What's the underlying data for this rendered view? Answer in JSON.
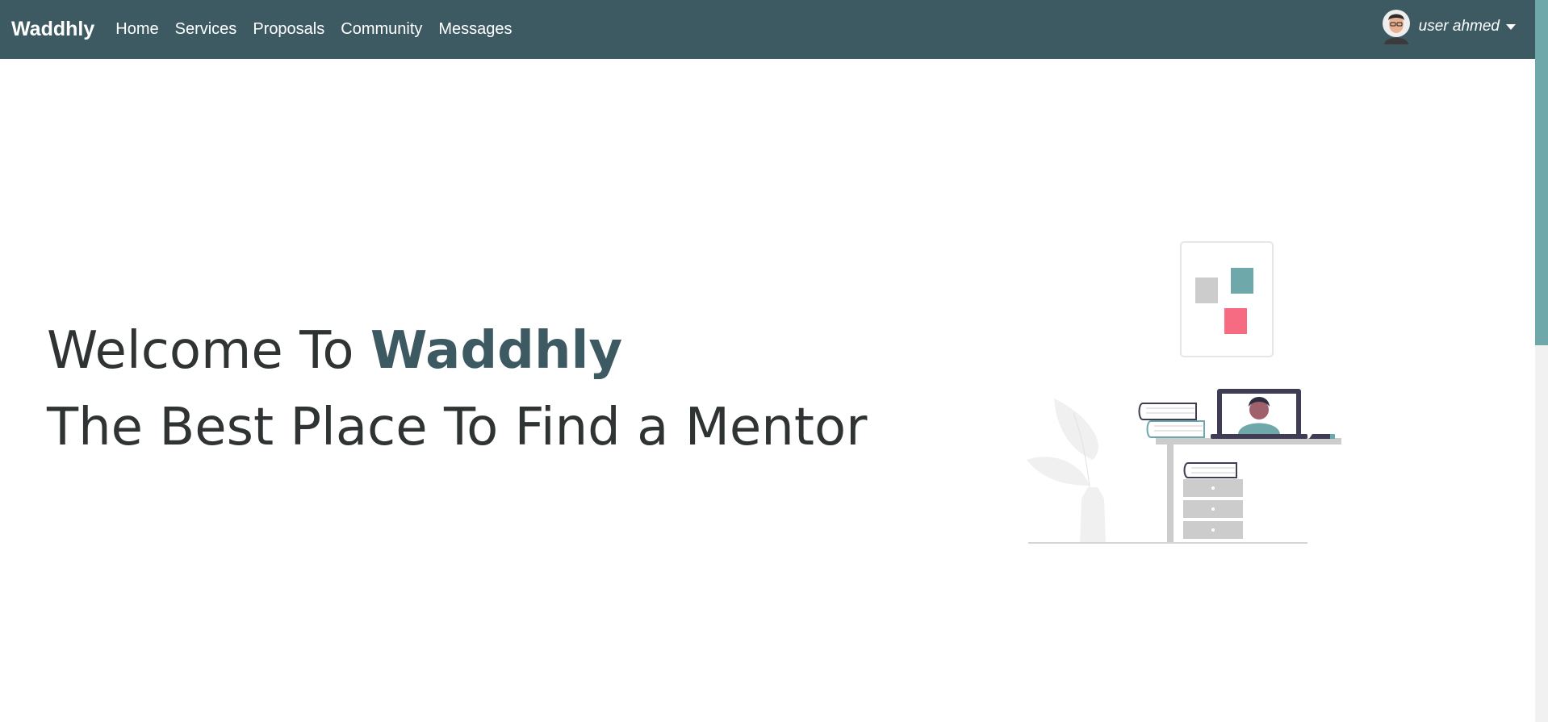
{
  "navbar": {
    "brand": "Waddhly",
    "links": [
      "Home",
      "Services",
      "Proposals",
      "Community",
      "Messages"
    ],
    "user": {
      "name": "user ahmed",
      "avatar_icon": "user-avatar-icon",
      "caret_icon": "caret-down-icon"
    }
  },
  "hero": {
    "line1_prefix": "Welcome To ",
    "line1_highlight": "Waddhly",
    "line2": "The Best Place To Find a Mentor"
  },
  "colors": {
    "navbar_bg": "#3d5a63",
    "accent": "#3d5a63",
    "teal": "#6ea8aa",
    "pink": "#f76b82"
  }
}
